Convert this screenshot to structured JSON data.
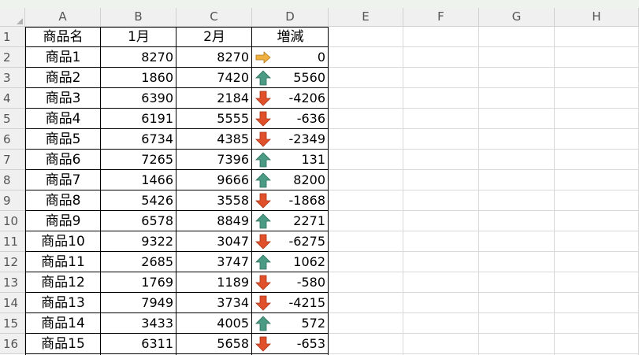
{
  "sheet": {
    "columns": [
      "A",
      "B",
      "C",
      "D",
      "E",
      "F",
      "G",
      "H"
    ],
    "row_numbers": [
      "1",
      "2",
      "3",
      "4",
      "5",
      "6",
      "7",
      "8",
      "9",
      "10",
      "11",
      "12",
      "13",
      "14",
      "15",
      "16"
    ],
    "headers": [
      "商品名",
      "1月",
      "2月",
      "増減"
    ],
    "rows": [
      {
        "name": "商品1",
        "m1": "8270",
        "m2": "8270",
        "icon": "right-arrow-icon",
        "diff": "0"
      },
      {
        "name": "商品2",
        "m1": "1860",
        "m2": "7420",
        "icon": "up-arrow-icon",
        "diff": "5560"
      },
      {
        "name": "商品3",
        "m1": "6390",
        "m2": "2184",
        "icon": "down-arrow-icon",
        "diff": "-4206"
      },
      {
        "name": "商品4",
        "m1": "6191",
        "m2": "5555",
        "icon": "down-arrow-icon",
        "diff": "-636"
      },
      {
        "name": "商品5",
        "m1": "6734",
        "m2": "4385",
        "icon": "down-arrow-icon",
        "diff": "-2349"
      },
      {
        "name": "商品6",
        "m1": "7265",
        "m2": "7396",
        "icon": "up-arrow-icon",
        "diff": "131"
      },
      {
        "name": "商品7",
        "m1": "1466",
        "m2": "9666",
        "icon": "up-arrow-icon",
        "diff": "8200"
      },
      {
        "name": "商品8",
        "m1": "5426",
        "m2": "3558",
        "icon": "down-arrow-icon",
        "diff": "-1868"
      },
      {
        "name": "商品9",
        "m1": "6578",
        "m2": "8849",
        "icon": "up-arrow-icon",
        "diff": "2271"
      },
      {
        "name": "商品10",
        "m1": "9322",
        "m2": "3047",
        "icon": "down-arrow-icon",
        "diff": "-6275"
      },
      {
        "name": "商品11",
        "m1": "2685",
        "m2": "3747",
        "icon": "up-arrow-icon",
        "diff": "1062"
      },
      {
        "name": "商品12",
        "m1": "1769",
        "m2": "1189",
        "icon": "down-arrow-icon",
        "diff": "-580"
      },
      {
        "name": "商品13",
        "m1": "7949",
        "m2": "3734",
        "icon": "down-arrow-icon",
        "diff": "-4215"
      },
      {
        "name": "商品14",
        "m1": "3433",
        "m2": "4005",
        "icon": "up-arrow-icon",
        "diff": "572"
      },
      {
        "name": "商品15",
        "m1": "6311",
        "m2": "5658",
        "icon": "down-arrow-icon",
        "diff": "-653"
      }
    ]
  },
  "colors": {
    "up": "#4a9a84",
    "down": "#e0502a",
    "flat": "#f0b040",
    "grid": "#d9d9d9",
    "header_bg": "#f0f0f0"
  }
}
